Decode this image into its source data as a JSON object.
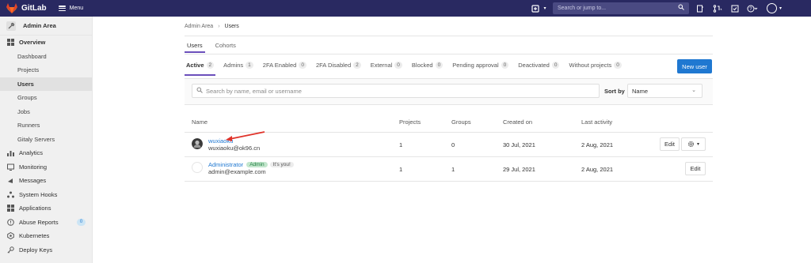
{
  "navbar": {
    "brand": "GitLab",
    "menu_label": "Menu",
    "search_placeholder": "Search or jump to..."
  },
  "sidebar": {
    "context_title": "Admin Area",
    "overview_label": "Overview",
    "overview_items": [
      "Dashboard",
      "Projects",
      "Users",
      "Groups",
      "Jobs",
      "Runners",
      "Gitaly Servers"
    ],
    "active_item": "Users",
    "items": [
      {
        "label": "Analytics",
        "icon": "chart-icon"
      },
      {
        "label": "Monitoring",
        "icon": "monitor-icon"
      },
      {
        "label": "Messages",
        "icon": "messages-icon"
      },
      {
        "label": "System Hooks",
        "icon": "hook-icon"
      },
      {
        "label": "Applications",
        "icon": "applications-icon"
      },
      {
        "label": "Abuse Reports",
        "icon": "abuse-icon",
        "badge": "0"
      },
      {
        "label": "Kubernetes",
        "icon": "kubernetes-icon"
      },
      {
        "label": "Deploy Keys",
        "icon": "key-icon"
      }
    ]
  },
  "breadcrumb": {
    "parent": "Admin Area",
    "current": "Users"
  },
  "top_tabs": [
    "Users",
    "Cohorts"
  ],
  "sub_tabs": [
    {
      "label": "Active",
      "count": "2"
    },
    {
      "label": "Admins",
      "count": "1"
    },
    {
      "label": "2FA Enabled",
      "count": "0"
    },
    {
      "label": "2FA Disabled",
      "count": "2"
    },
    {
      "label": "External",
      "count": "0"
    },
    {
      "label": "Blocked",
      "count": "0"
    },
    {
      "label": "Pending approval",
      "count": "0"
    },
    {
      "label": "Deactivated",
      "count": "0"
    },
    {
      "label": "Without projects",
      "count": "0"
    }
  ],
  "new_user_label": "New user",
  "filter": {
    "placeholder": "Search by name, email or username",
    "sort_label": "Sort by",
    "sort_value": "Name"
  },
  "table": {
    "headers": {
      "name": "Name",
      "projects": "Projects",
      "groups": "Groups",
      "created": "Created on",
      "activity": "Last activity"
    },
    "rows": [
      {
        "name": "wuxiaoku",
        "email": "wuxiaoku@ok96.cn",
        "projects": "1",
        "groups": "0",
        "created": "30 Jul, 2021",
        "activity": "2 Aug, 2021",
        "edit": "Edit"
      },
      {
        "name": "Administrator",
        "admin_badge": "Admin",
        "you_badge": "It's you!",
        "email": "admin@example.com",
        "projects": "1",
        "groups": "1",
        "created": "29 Jul, 2021",
        "activity": "2 Aug, 2021",
        "edit": "Edit"
      }
    ]
  },
  "colors": {
    "navbar": "#292961",
    "accent": "#1f78d1",
    "tab_underline": "#6b4fbb",
    "arrow": "#e0332a"
  }
}
